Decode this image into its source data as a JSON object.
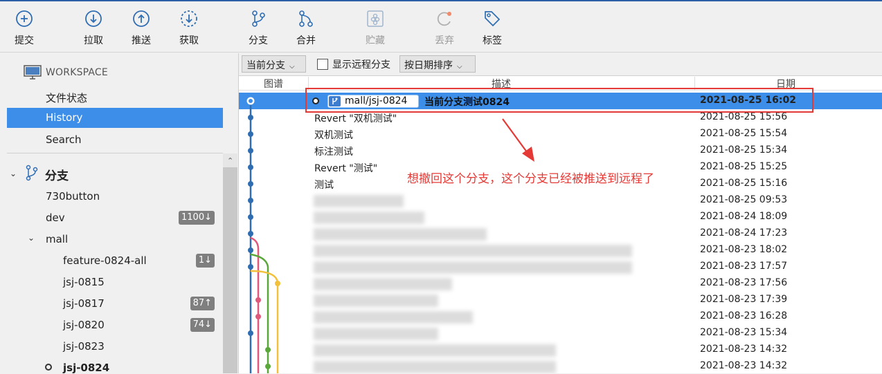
{
  "toolbar": {
    "commit": "提交",
    "pull": "拉取",
    "push": "推送",
    "fetch": "获取",
    "branch": "分支",
    "merge": "合并",
    "stash": "贮藏",
    "discard": "丢弃",
    "tag": "标签"
  },
  "sidebar": {
    "workspace": "WORKSPACE",
    "file_status": "文件状态",
    "history": "History",
    "search": "Search",
    "branches_title": "分支",
    "branches": [
      {
        "name": "730button"
      },
      {
        "name": "dev",
        "badge": "1100↓"
      },
      {
        "name": "mall"
      },
      {
        "name": "feature-0824-all",
        "badge": "1↓"
      },
      {
        "name": "jsj-0815"
      },
      {
        "name": "jsj-0817",
        "badge": "87↑"
      },
      {
        "name": "jsj-0820",
        "badge": "74↓"
      },
      {
        "name": "jsj-0823"
      },
      {
        "name": "jsj-0824"
      }
    ]
  },
  "filter": {
    "current_branch": "当前分支",
    "show_remote": "显示远程分支",
    "sort_by_date": "按日期排序"
  },
  "columns": {
    "graph": "图谱",
    "description": "描述",
    "date": "日期"
  },
  "commits": [
    {
      "branch_tag": "mall/jsj-0824",
      "desc": "当前分支测试0824",
      "date": "2021-08-25 16:02"
    },
    {
      "desc": "Revert \"双机测试\"",
      "date": "2021-08-25 15:56"
    },
    {
      "desc": "双机测试",
      "date": "2021-08-25 15:54"
    },
    {
      "desc": "标注测试",
      "date": "2021-08-25 15:34"
    },
    {
      "desc": "Revert \"测试\"",
      "date": "2021-08-25 15:25"
    },
    {
      "desc": "测试",
      "date": "2021-08-25 15:16"
    },
    {
      "desc": "",
      "date": "2021-08-25 09:53"
    },
    {
      "desc": "",
      "date": "2021-08-24 18:09"
    },
    {
      "desc": "",
      "date": "2021-08-24 17:23"
    },
    {
      "desc": "",
      "date": "2021-08-23 18:02"
    },
    {
      "desc": "",
      "date": "2021-08-23 17:57"
    },
    {
      "desc": "",
      "date": "2021-08-23 17:56"
    },
    {
      "desc": "",
      "date": "2021-08-23 17:39"
    },
    {
      "desc": "",
      "date": "2021-08-23 16:28"
    },
    {
      "desc": "",
      "date": "2021-08-23 15:34"
    },
    {
      "desc": "",
      "date": "2021-08-23 14:32"
    },
    {
      "desc": "",
      "date": "2021-08-23 14:32"
    }
  ],
  "annotation": "想撤回这个分支，这个分支已经被推送到远程了",
  "colors": {
    "selection": "#3d8ee8",
    "annotation_red": "#e53935",
    "graph_blue": "#2f6db3",
    "graph_pink": "#e0587a",
    "graph_green": "#5aa83a",
    "graph_yellow": "#f2c03a"
  }
}
